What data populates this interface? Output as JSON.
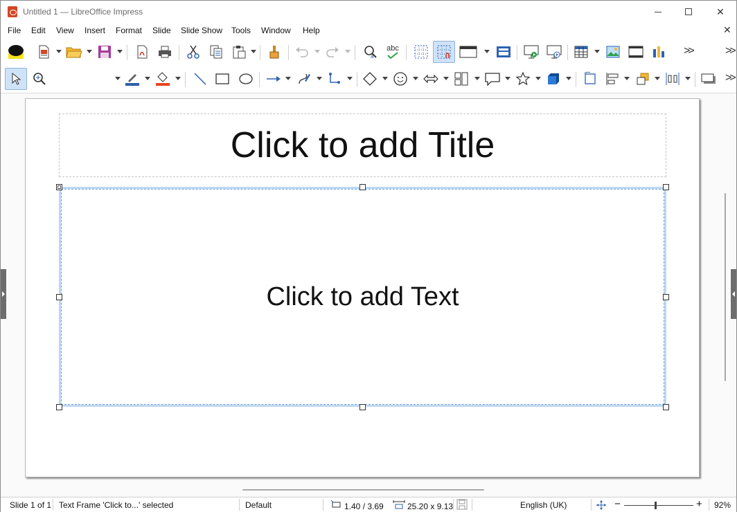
{
  "window": {
    "title": "Untitled 1 — LibreOffice Impress"
  },
  "menu": {
    "items": [
      "File",
      "Edit",
      "View",
      "Insert",
      "Format",
      "Slide",
      "Slide Show",
      "Tools",
      "Window",
      "Help"
    ]
  },
  "toolbar_standard": {
    "icons": [
      "comment-icon",
      "new-doc-icon",
      "open-folder-icon",
      "save-icon",
      "export-pdf-icon",
      "print-icon",
      "cut-icon",
      "copy-icon",
      "paste-icon",
      "clone-format-icon",
      "undo-icon",
      "redo-icon",
      "find-replace-icon",
      "spellcheck-icon",
      "grid-icon",
      "snap-grid-icon",
      "display-views-icon",
      "master-slide-icon",
      "start-slideshow-icon",
      "start-current-slide-icon",
      "insert-table-icon",
      "insert-image-icon",
      "insert-media-icon",
      "insert-chart-icon"
    ],
    "spellcheck_label": "abc"
  },
  "toolbar_drawing": {
    "icons": [
      "select-icon",
      "zoom-pan-icon",
      "line-color-icon",
      "fill-color-icon",
      "line-icon",
      "rectangle-icon",
      "ellipse-icon",
      "arrow-line-icon",
      "curve-icon",
      "connector-icon",
      "basic-shapes-icon",
      "symbol-shapes-icon",
      "block-arrows-icon",
      "flowchart-icon",
      "callout-icon",
      "stars-icon",
      "3d-objects-icon",
      "rotate-icon",
      "align-icon",
      "arrange-icon",
      "distribute-icon",
      "shadow-icon"
    ],
    "line_color": "#2f5faa",
    "fill_color": "#e8451f"
  },
  "slide": {
    "title_placeholder": "Click to add Title",
    "text_placeholder": "Click to add Text"
  },
  "status": {
    "slide_counter": "Slide 1 of 1",
    "selection": "Text Frame 'Click to...' selected",
    "master": "Default",
    "position": "1.40 / 3.69",
    "size": "25.20 x 9.13",
    "language": "English (UK)",
    "zoom": "92%"
  },
  "zoom_slider": {
    "level_percent": 92
  }
}
